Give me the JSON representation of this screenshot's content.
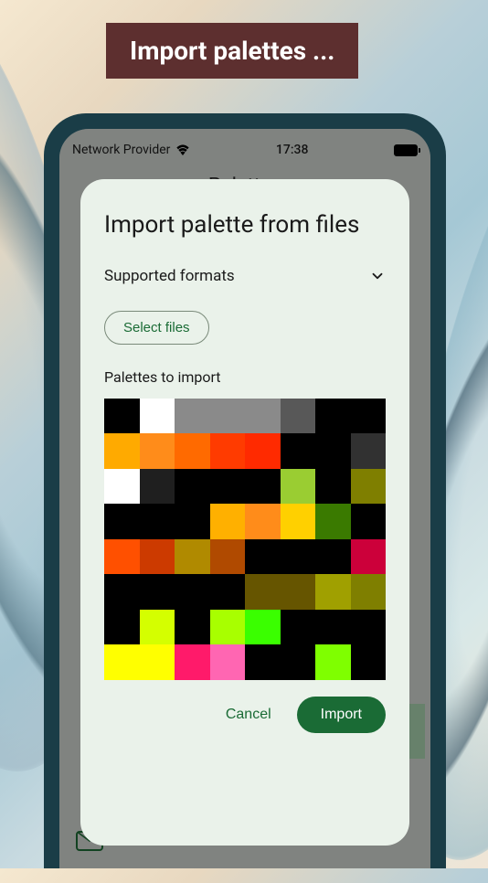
{
  "banner": {
    "text": "Import palettes ..."
  },
  "status": {
    "provider": "Network Provider",
    "time": "17:38"
  },
  "app": {
    "title": "Palettes"
  },
  "modal": {
    "title": "Import palette from files",
    "supported_label": "Supported formats",
    "select_files_label": "Select files",
    "palettes_label": "Palettes to import",
    "cancel_label": "Cancel",
    "import_label": "Import"
  },
  "palette_colors": [
    "#000000",
    "#ffffff",
    "#8a8a8a",
    "#8a8a8a",
    "#8a8a8a",
    "#585858",
    "#000000",
    "#000000",
    "#ffaa00",
    "#ff8c1a",
    "#ff6a00",
    "#ff3b00",
    "#ff2a00",
    "#000000",
    "#000000",
    "#313131",
    "#ffffff",
    "#1f1f1f",
    "#000000",
    "#000000",
    "#000000",
    "#9acd32",
    "#000000",
    "#7f7f00",
    "#000000",
    "#000000",
    "#000000",
    "#ffb000",
    "#ff8c1a",
    "#ffd000",
    "#3a7a00",
    "#000000",
    "#ff5000",
    "#cc3a00",
    "#b08a00",
    "#b04a00",
    "#000000",
    "#000000",
    "#000000",
    "#cc003a",
    "#000000",
    "#000000",
    "#000000",
    "#000000",
    "#665500",
    "#665500",
    "#a0a000",
    "#7f7f00",
    "#000000",
    "#d4ff00",
    "#000000",
    "#a8ff00",
    "#3aff00",
    "#000000",
    "#000000",
    "#000000",
    "#ffff00",
    "#ffff00",
    "#ff1a6a",
    "#ff66b2",
    "#000000",
    "#000000",
    "#7fff00",
    "#000000"
  ]
}
